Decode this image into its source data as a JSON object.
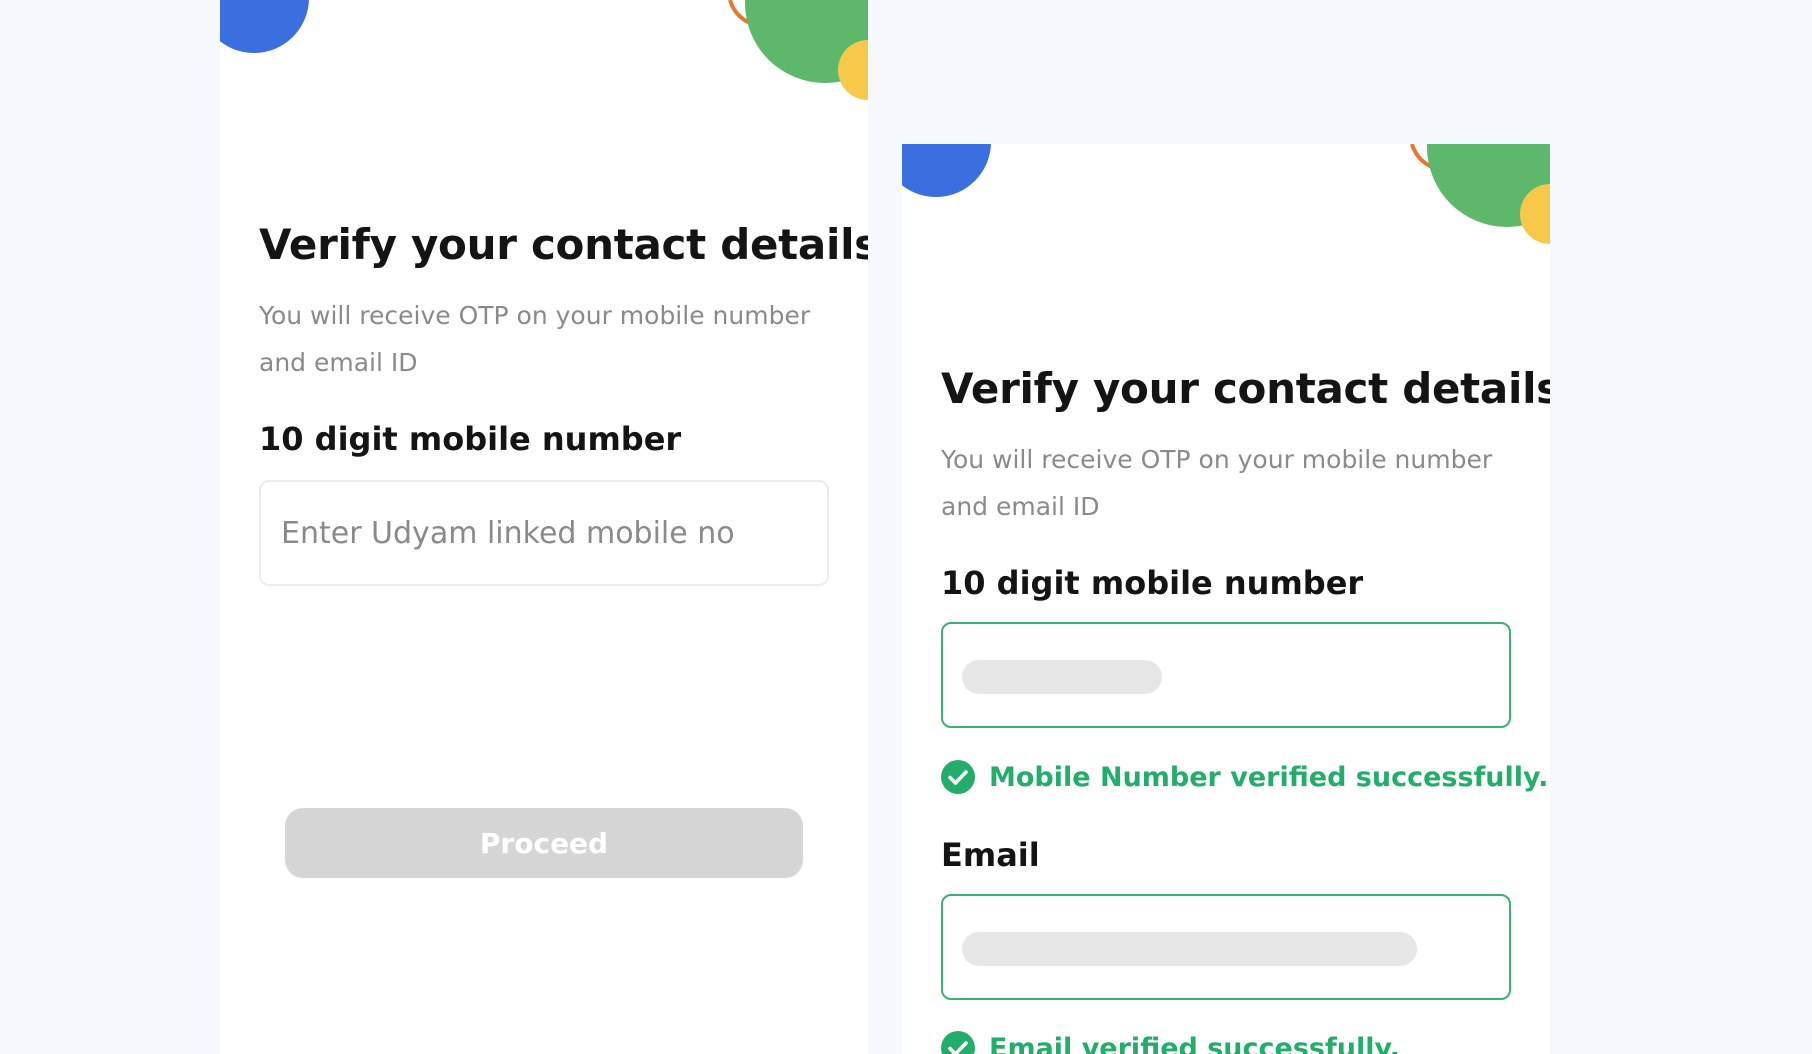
{
  "colors": {
    "page_background": "#f5f8fd",
    "screen_background": "#ffffff",
    "deco_blue": "#3b6fdf",
    "deco_green": "#5eb86b",
    "deco_yellow": "#f7c84a",
    "deco_orange": "#e8772e",
    "success_green": "#22ad6a",
    "verified_border": "#3bb273",
    "button_disabled": "#d5d5d5"
  },
  "left_screen": {
    "title": "Verify your contact details",
    "subtitle": "You will receive OTP on your mobile number and email ID",
    "mobile_label": "10 digit mobile number",
    "mobile_placeholder": "Enter Udyam linked mobile no",
    "proceed_label": "Proceed"
  },
  "right_screen": {
    "title": "Verify your contact details",
    "subtitle": "You will receive OTP on your mobile number and email ID",
    "mobile_label": "10 digit mobile number",
    "mobile_success": "Mobile Number verified successfully.",
    "email_label": "Email",
    "email_success": "Email verified successfully.",
    "success_icon": "check-circle-icon"
  }
}
